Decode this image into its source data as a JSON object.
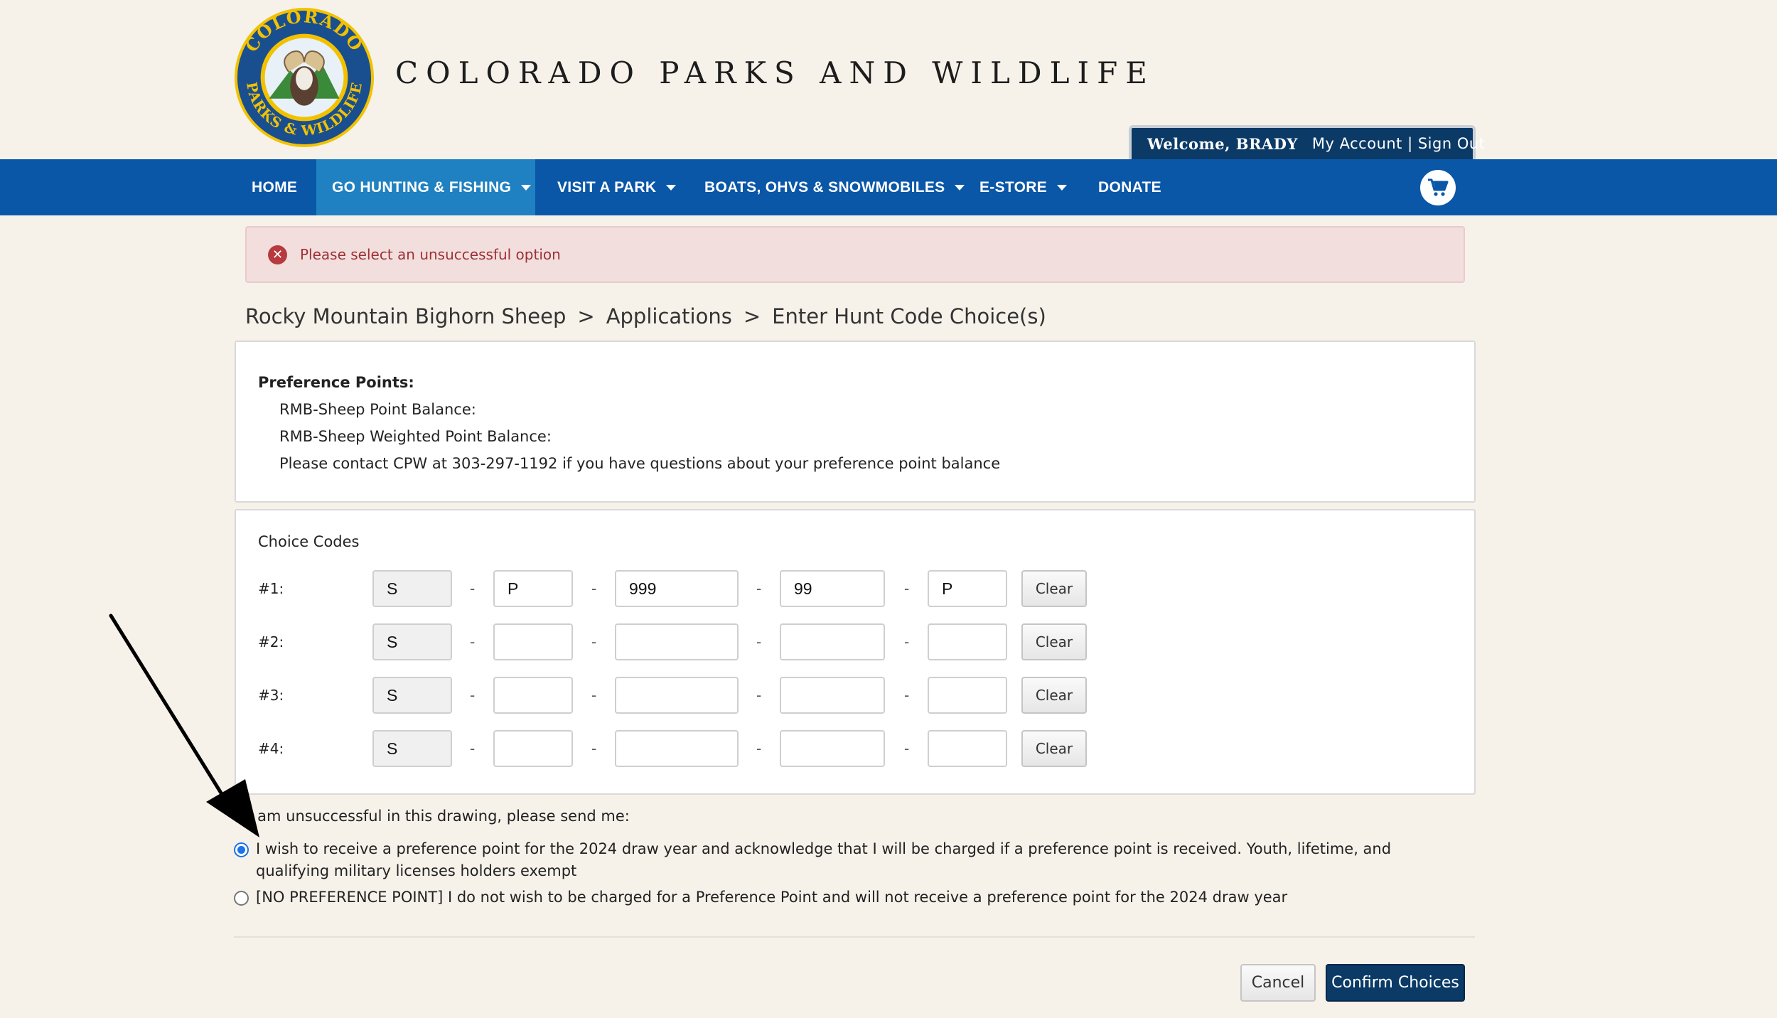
{
  "header": {
    "site_title": "COLORADO PARKS AND WILDLIFE",
    "logo_top_text": "COLORADO",
    "logo_bottom_text": "PARKS & WILDLIFE",
    "welcome": "Welcome, BRADY",
    "account_links": "My Account | Sign Out"
  },
  "nav": {
    "items": [
      {
        "label": "HOME"
      },
      {
        "label": "GO HUNTING & FISHING"
      },
      {
        "label": "VISIT A PARK"
      },
      {
        "label": "BOATS, OHVS & SNOWMOBILES"
      },
      {
        "label": "E-STORE"
      },
      {
        "label": "DONATE"
      }
    ],
    "cart_icon": "shopping-cart-icon"
  },
  "alert": {
    "message": "Please select an unsuccessful option",
    "icon": "error-x-icon",
    "color": "#9b3235"
  },
  "breadcrumb": {
    "items": [
      "Rocky Mountain Bighorn Sheep",
      "Applications",
      "Enter Hunt Code Choice(s)"
    ],
    "separator": ">"
  },
  "preference_points": {
    "heading": "Preference Points:",
    "lines": [
      "RMB-Sheep Point Balance:",
      "RMB-Sheep Weighted Point Balance:",
      "Please contact CPW at 303-297-1192 if you have questions about your preference point balance"
    ]
  },
  "choice_codes": {
    "heading": "Choice Codes",
    "dash": "-",
    "clear_label": "Clear",
    "rows": [
      {
        "label": "#1:",
        "fields": [
          "S",
          "P",
          "999",
          "99",
          "P"
        ]
      },
      {
        "label": "#2:",
        "fields": [
          "S",
          "",
          "",
          "",
          ""
        ]
      },
      {
        "label": "#3:",
        "fields": [
          "S",
          "",
          "",
          "",
          ""
        ]
      },
      {
        "label": "#4:",
        "fields": [
          "S",
          "",
          "",
          "",
          ""
        ]
      }
    ]
  },
  "unsuccessful": {
    "label": "If I am unsuccessful in this drawing, please send me:",
    "options": [
      {
        "text": "I wish to receive a preference point for the 2024 draw year and acknowledge that I will be charged if a preference point is received. Youth, lifetime, and qualifying military licenses holders exempt",
        "checked": true
      },
      {
        "text": "[NO PREFERENCE POINT] I do not wish to be charged for a Preference Point and will not receive a preference point for the 2024 draw year",
        "checked": false
      }
    ]
  },
  "actions": {
    "cancel": "Cancel",
    "confirm": "Confirm Choices"
  },
  "colors": {
    "nav_bg": "#0a57a8",
    "nav_active": "#1f81c1",
    "primary_button": "#0b3a66",
    "page_bg": "#f6f2ea"
  }
}
